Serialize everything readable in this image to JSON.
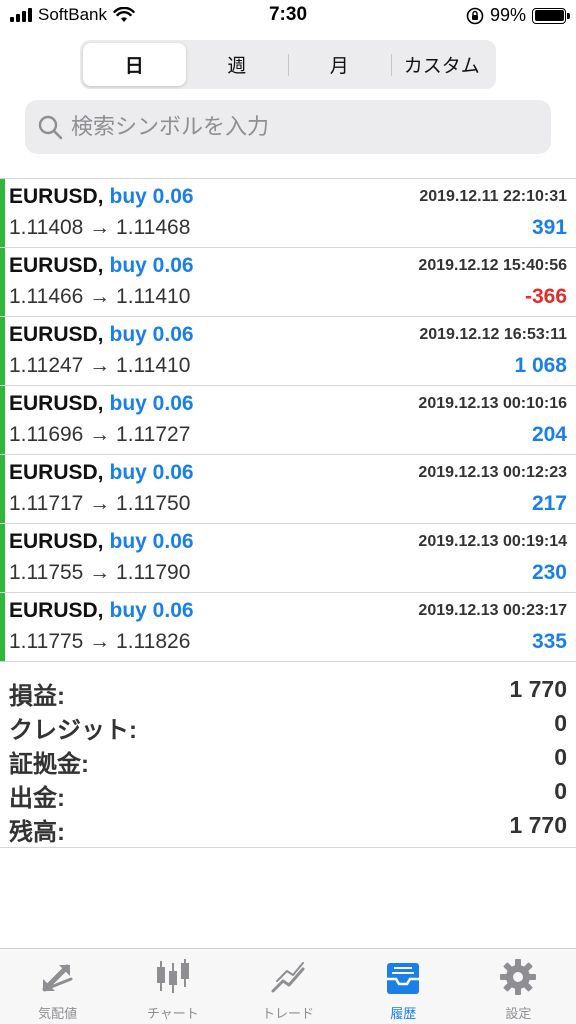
{
  "status_bar": {
    "carrier": "SoftBank",
    "time": "7:30",
    "battery": "99%"
  },
  "period_tabs": [
    {
      "label": "日",
      "active": true
    },
    {
      "label": "週",
      "active": false
    },
    {
      "label": "月",
      "active": false
    },
    {
      "label": "カスタム",
      "active": false
    }
  ],
  "search": {
    "placeholder": "検索シンボルを入力",
    "value": ""
  },
  "deals": [
    {
      "symbol": "EURUSD,",
      "type": "buy 0.06",
      "time": "2019.12.11 22:10:31",
      "prices": "1.11408 → 1.11468",
      "profit": "391"
    },
    {
      "symbol": "EURUSD,",
      "type": "buy 0.06",
      "time": "2019.12.12 15:40:56",
      "prices": "1.11466 → 1.11410",
      "profit": "-366"
    },
    {
      "symbol": "EURUSD,",
      "type": "buy 0.06",
      "time": "2019.12.12 16:53:11",
      "prices": "1.11247 → 1.11410",
      "profit": "1 068"
    },
    {
      "symbol": "EURUSD,",
      "type": "buy 0.06",
      "time": "2019.12.13 00:10:16",
      "prices": "1.11696 → 1.11727",
      "profit": "204"
    },
    {
      "symbol": "EURUSD,",
      "type": "buy 0.06",
      "time": "2019.12.13 00:12:23",
      "prices": "1.11717 → 1.11750",
      "profit": "217"
    },
    {
      "symbol": "EURUSD,",
      "type": "buy 0.06",
      "time": "2019.12.13 00:19:14",
      "prices": "1.11755 → 1.11790",
      "profit": "230"
    },
    {
      "symbol": "EURUSD,",
      "type": "buy 0.06",
      "time": "2019.12.13 00:23:17",
      "prices": "1.11775 → 1.11826",
      "profit": "335"
    }
  ],
  "summary": [
    {
      "label": "損益:",
      "value": "1 770"
    },
    {
      "label": "クレジット:",
      "value": "0"
    },
    {
      "label": "証拠金:",
      "value": "0"
    },
    {
      "label": "出金:",
      "value": "0"
    },
    {
      "label": "残高:",
      "value": "1 770"
    }
  ],
  "tab_bar": [
    {
      "label": "気配値",
      "icon": "quotes-icon",
      "active": false
    },
    {
      "label": "チャート",
      "icon": "chart-icon",
      "active": false
    },
    {
      "label": "トレード",
      "icon": "trade-icon",
      "active": false
    },
    {
      "label": "履歴",
      "icon": "history-icon",
      "active": true
    },
    {
      "label": "設定",
      "icon": "settings-icon",
      "active": false
    }
  ],
  "colors": {
    "accent_blue": "#1a7fe8",
    "loss_red": "#e52b2b",
    "deal_bar_green": "#2fb63c",
    "inactive_gray": "#8e8e93"
  }
}
